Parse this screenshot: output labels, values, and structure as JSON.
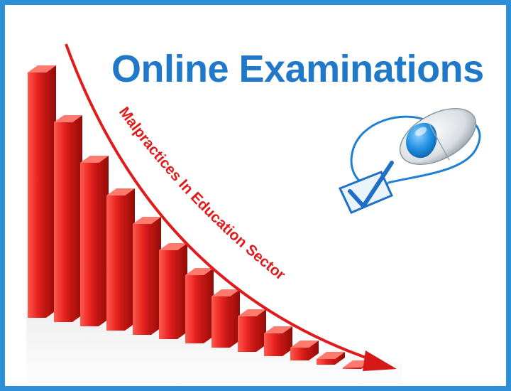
{
  "heading": {
    "title": "Online Examinations",
    "curve_caption": "Malpractices In Education Sector"
  },
  "colors": {
    "frame": "#2e8fd6",
    "title": "#1f78c8",
    "bar_red": "#e8221f",
    "curve_red": "#e11b1b",
    "mouse_blue": "#1f7fd1"
  },
  "illustration": {
    "bar_staircase": "decreasing",
    "icons": [
      "computer-mouse-icon",
      "checkbox-checkmark-icon"
    ]
  }
}
